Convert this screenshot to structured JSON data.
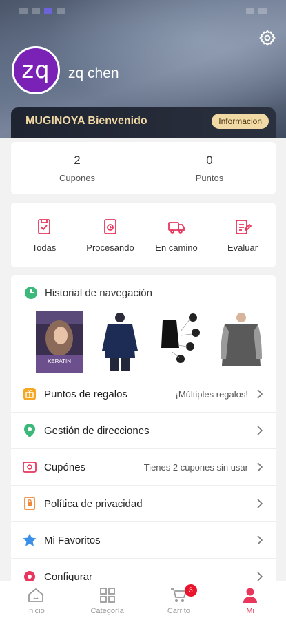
{
  "header": {
    "avatar_initials": "zq",
    "username": "zq chen",
    "vip_text": "MUGINOYA Bienvenido",
    "info_button": "Informacion"
  },
  "stats": [
    {
      "value": "2",
      "label": "Cupones"
    },
    {
      "value": "0",
      "label": "Puntos"
    }
  ],
  "orders": [
    {
      "label": "Todas",
      "icon": "clipboard-icon"
    },
    {
      "label": "Procesando",
      "icon": "processing-icon"
    },
    {
      "label": "En camino",
      "icon": "truck-icon"
    },
    {
      "label": "Evaluar",
      "icon": "edit-icon"
    }
  ],
  "history": {
    "title": "Historial de navegación",
    "products": [
      {
        "label": "KERATIN"
      },
      {
        "label": ""
      },
      {
        "label": ""
      },
      {
        "label": ""
      }
    ]
  },
  "menu": [
    {
      "label": "Puntos de regalos",
      "value": "¡Múltiples regalos!",
      "icon": "gift-icon",
      "color": "#f5a623"
    },
    {
      "label": "Gestión de direcciones",
      "value": "",
      "icon": "location-icon",
      "color": "#3cb97a"
    },
    {
      "label": "Cupónes",
      "value": "Tienes 2 cupones sin usar",
      "icon": "coupon-icon",
      "color": "#e8365d"
    },
    {
      "label": "Política de privacidad",
      "value": "",
      "icon": "privacy-icon",
      "color": "#f08a3a"
    },
    {
      "label": "Mi Favoritos",
      "value": "",
      "icon": "star-icon",
      "color": "#3a8fe8"
    },
    {
      "label": "Configurar",
      "value": "",
      "icon": "settings-icon",
      "color": "#e8365d"
    }
  ],
  "nav": [
    {
      "label": "Inicio",
      "icon": "home-icon"
    },
    {
      "label": "Categoría",
      "icon": "grid-icon"
    },
    {
      "label": "Carrito",
      "icon": "cart-icon",
      "badge": "3"
    },
    {
      "label": "Mi",
      "icon": "user-icon"
    }
  ],
  "colors": {
    "accent": "#e8365d",
    "avatar": "#7b22b6",
    "vip_gold": "#f1d9a5"
  }
}
